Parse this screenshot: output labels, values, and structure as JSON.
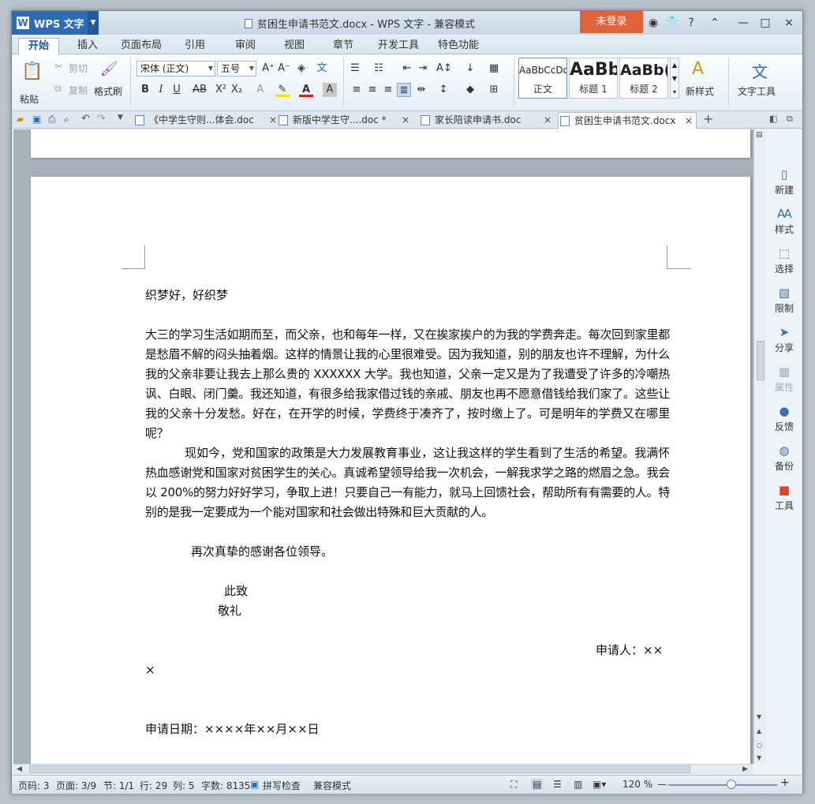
{
  "app": {
    "name": "WPS 文字",
    "logo": "W",
    "title_text": "贫困生申请书范文.docx - WPS 文字 - 兼容模式",
    "login": "未登录"
  },
  "window_controls": {
    "shirt": "👕",
    "help": "?",
    "min": "—",
    "max": "□",
    "close": "×"
  },
  "tabs": [
    "开始",
    "插入",
    "页面布局",
    "引用",
    "审阅",
    "视图",
    "章节",
    "开发工具",
    "特色功能"
  ],
  "ribbon": {
    "paste": "粘贴",
    "cut": "剪切",
    "copy": "复制",
    "format_painter": "格式刷",
    "font_name": "宋体 (正文)",
    "font_size": "五号",
    "style_gallery": [
      {
        "preview": "AaBbCcDd",
        "label": "正文"
      },
      {
        "preview": "AaBb",
        "label": "标题 1"
      },
      {
        "preview": "AaBb(",
        "label": "标题 2"
      }
    ],
    "new_style": "新样式",
    "text_tools": "文字工具"
  },
  "doc_tabs": [
    {
      "label": "《中学生守则...体会.doc",
      "active": false
    },
    {
      "label": "新版中学生守....doc *",
      "active": false
    },
    {
      "label": "家长陪读申请书.doc",
      "active": false
    },
    {
      "label": "贫困生申请书范文.docx",
      "active": true
    }
  ],
  "document": {
    "greeting": "织梦好，好织梦",
    "para1": "大三的学习生活如期而至，而父亲，也和每年一样，又在挨家挨户的为我的学费奔走。每次回到家里都是愁眉不解的闷头抽着烟。这样的情景让我的心里很难受。因为我知道，别的朋友也许不理解，为什么我的父亲非要让我去上那么贵的 XXXXXX 大学。我也知道，父亲一定又是为了我遭受了许多的冷嘲热讽、白眼、闭门羹。我还知道，有很多给我家借过钱的亲戚、朋友也再不愿意借钱给我们家了。这些让我的父亲十分发愁。好在，在开学的时候，学费终于凑齐了，按时缴上了。可是明年的学费又在哪里呢？",
    "para2": "现如今，党和国家的政策是大力发展教育事业，这让我这样的学生看到了生活的希望。我满怀热血感谢党和国家对贫困学生的关心。真诚希望领导给我一次机会，一解我求学之路的燃眉之急。我会以 200%的努力好好学习，争取上进！只要自己一有能力，就马上回馈社会，帮助所有有需要的人。特别的是我一定要成为一个能对国家和社会做出特殊和巨大贡献的人。",
    "thanks": "再次真挚的感谢各位领导。",
    "closing1": "此致",
    "closing2": "敬礼",
    "applicant": "申请人：××",
    "applicant_wrap": "×",
    "date": "申请日期：××××年××月××日"
  },
  "right_pane": [
    {
      "icon": "new-icon",
      "label": "新建",
      "disabled": false
    },
    {
      "icon": "style-icon",
      "label": "样式",
      "disabled": false
    },
    {
      "icon": "select-icon",
      "label": "选择",
      "disabled": false
    },
    {
      "icon": "restrict-icon",
      "label": "限制",
      "disabled": false
    },
    {
      "icon": "share-icon",
      "label": "分享",
      "disabled": false
    },
    {
      "icon": "properties-icon",
      "label": "属性",
      "disabled": true
    },
    {
      "icon": "feedback-icon",
      "label": "反馈",
      "disabled": false
    },
    {
      "icon": "backup-icon",
      "label": "备份",
      "disabled": false
    },
    {
      "icon": "toolbox-icon",
      "label": "工具",
      "disabled": false
    }
  ],
  "status": {
    "page": "页码: 3",
    "pages": "页面: 3/9",
    "section": "节: 1/1",
    "row": "行: 29",
    "col": "列: 5",
    "words": "字数: 8135",
    "spell": "拼写检查",
    "mode": "兼容模式",
    "zoom": "120 %"
  }
}
